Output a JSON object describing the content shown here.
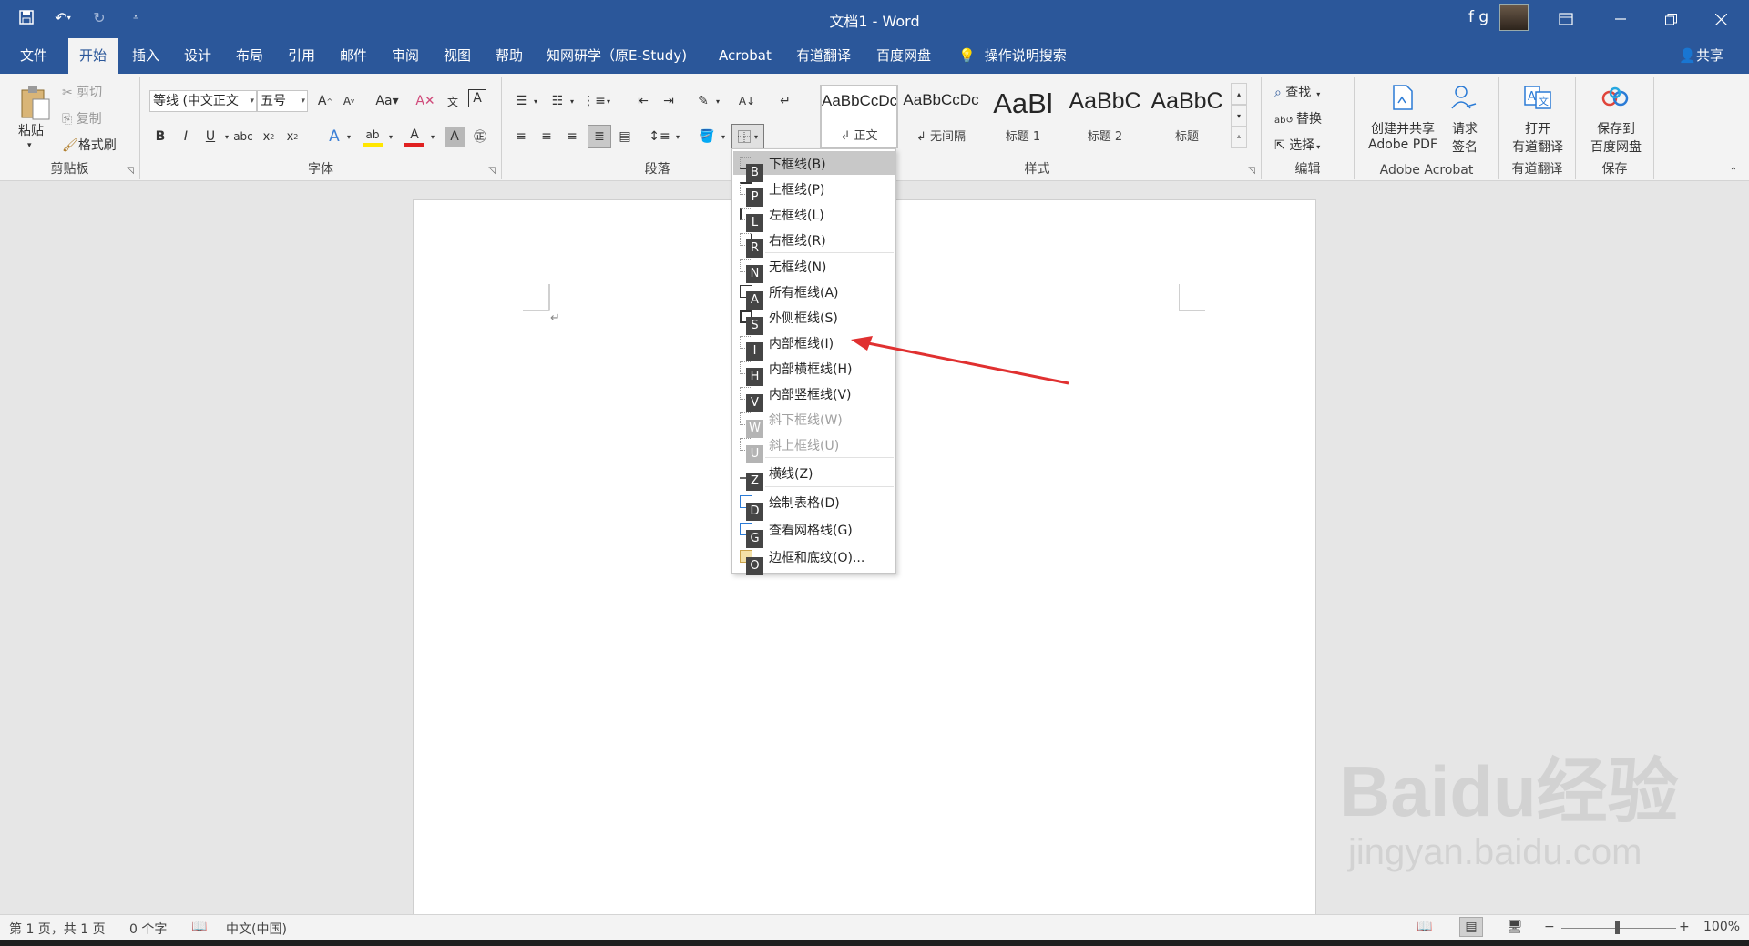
{
  "title_bar": {
    "title": "文档1  -  Word",
    "user": "f g"
  },
  "tabs": [
    "文件",
    "开始",
    "插入",
    "设计",
    "布局",
    "引用",
    "邮件",
    "审阅",
    "视图",
    "帮助",
    "知网研学（原E-Study)",
    "Acrobat",
    "有道翻译",
    "百度网盘"
  ],
  "tell_me": "操作说明搜索",
  "share": "共享",
  "clipboard": {
    "paste": "粘贴",
    "cut": "剪切",
    "copy": "复制",
    "format_painter": "格式刷",
    "label": "剪贴板"
  },
  "font": {
    "name": "等线 (中文正文",
    "size": "五号",
    "label": "字体"
  },
  "paragraph": {
    "label": "段落"
  },
  "styles": {
    "label": "样式",
    "items": [
      {
        "preview": "AaBbCcDc",
        "name": "↲ 正文"
      },
      {
        "preview": "AaBbCcDc",
        "name": "↲ 无间隔"
      },
      {
        "preview": "AaBl",
        "name": "标题 1"
      },
      {
        "preview": "AaBbC",
        "name": "标题 2"
      },
      {
        "preview": "AaBbC",
        "name": "标题"
      }
    ]
  },
  "editing": {
    "find": "查找",
    "replace": "替换",
    "select": "选择",
    "label": "编辑"
  },
  "acrobat": {
    "create_share_1": "创建并共享",
    "create_share_2": "Adobe PDF",
    "request_1": "请求",
    "request_2": "签名",
    "label": "Adobe Acrobat"
  },
  "youdao": {
    "open_1": "打开",
    "open_2": "有道翻译",
    "label": "有道翻译"
  },
  "baidu": {
    "save_1": "保存到",
    "save_2": "百度网盘",
    "label": "保存"
  },
  "border_menu": {
    "items": [
      {
        "label": "下框线(B)",
        "key": "B",
        "highlighted": true,
        "disabled": false
      },
      {
        "label": "上框线(P)",
        "key": "P",
        "highlighted": false,
        "disabled": false
      },
      {
        "label": "左框线(L)",
        "key": "L",
        "highlighted": false,
        "disabled": false
      },
      {
        "label": "右框线(R)",
        "key": "R",
        "highlighted": false,
        "disabled": false
      },
      {
        "label": "无框线(N)",
        "key": "N",
        "highlighted": false,
        "disabled": false
      },
      {
        "label": "所有框线(A)",
        "key": "A",
        "highlighted": false,
        "disabled": false
      },
      {
        "label": "外侧框线(S)",
        "key": "S",
        "highlighted": false,
        "disabled": false
      },
      {
        "label": "内部框线(I)",
        "key": "I",
        "highlighted": false,
        "disabled": false
      },
      {
        "label": "内部横框线(H)",
        "key": "H",
        "highlighted": false,
        "disabled": false
      },
      {
        "label": "内部竖框线(V)",
        "key": "V",
        "highlighted": false,
        "disabled": false
      },
      {
        "label": "斜下框线(W)",
        "key": "W",
        "highlighted": false,
        "disabled": true
      },
      {
        "label": "斜上框线(U)",
        "key": "U",
        "highlighted": false,
        "disabled": true
      },
      {
        "label": "横线(Z)",
        "key": "Z",
        "highlighted": false,
        "disabled": false
      },
      {
        "label": "绘制表格(D)",
        "key": "D",
        "highlighted": false,
        "disabled": false
      },
      {
        "label": "查看网格线(G)",
        "key": "G",
        "highlighted": false,
        "disabled": false
      },
      {
        "label": "边框和底纹(O)...",
        "key": "O",
        "highlighted": false,
        "disabled": false
      }
    ]
  },
  "status": {
    "page": "第 1 页，共 1 页",
    "words": "0 个字",
    "language": "中文(中国)",
    "zoom": "100%"
  },
  "watermark": {
    "brand": "Baidu经验",
    "url": "jingyan.baidu.com"
  },
  "colors": {
    "brand": "#2b579a",
    "annotation_arrow": "#e03030"
  }
}
